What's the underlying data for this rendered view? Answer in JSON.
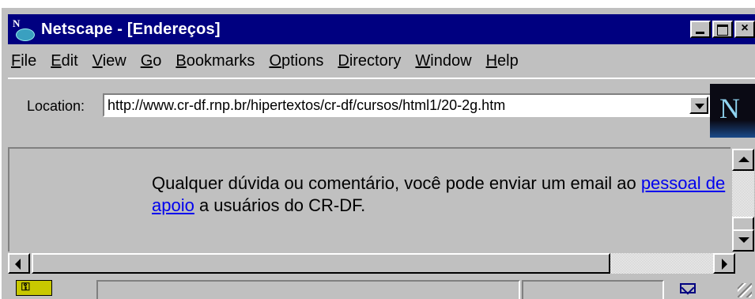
{
  "window": {
    "title": "Netscape - [Endereços]",
    "buttons": {
      "minimize": "minimize",
      "maximize": "maximize",
      "close": "×"
    }
  },
  "menubar": {
    "items": [
      {
        "label": "File",
        "access": "F"
      },
      {
        "label": "Edit",
        "access": "E"
      },
      {
        "label": "View",
        "access": "V"
      },
      {
        "label": "Go",
        "access": "G"
      },
      {
        "label": "Bookmarks",
        "access": "B"
      },
      {
        "label": "Options",
        "access": "O"
      },
      {
        "label": "Directory",
        "access": "D"
      },
      {
        "label": "Window",
        "access": "W"
      },
      {
        "label": "Help",
        "access": "H"
      }
    ]
  },
  "location": {
    "label": "Location:",
    "url": "http://www.cr-df.rnp.br/hipertextos/cr-df/cursos/html1/20-2g.htm"
  },
  "logo": {
    "letter": "N"
  },
  "content": {
    "text_before_link": "Qualquer dúvida ou comentário, você pode enviar um email ao ",
    "link_text": "pessoal de apoio",
    "text_after_link": " a usuários do CR-DF."
  },
  "statusbar": {
    "icons": [
      "security-key-icon",
      "mail-icon"
    ],
    "text": ""
  },
  "colors": {
    "titlebar": "#000080",
    "chrome": "#c0c0c0",
    "link": "#0000ee"
  }
}
